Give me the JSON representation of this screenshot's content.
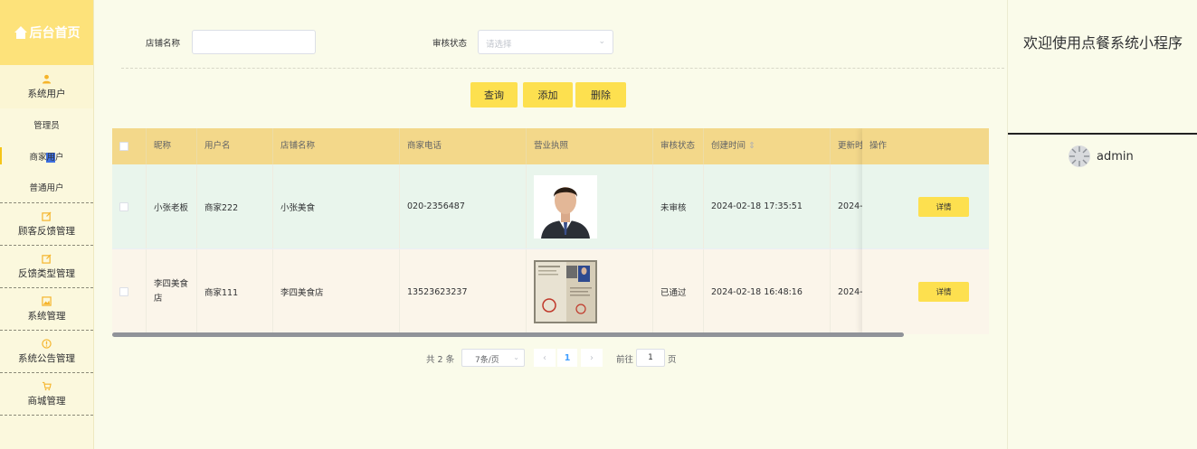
{
  "sidebar": {
    "home_label": "后台首页",
    "groups": [
      {
        "label": "系统用户",
        "icon": "user-icon"
      },
      {
        "label": "顾客反馈管理",
        "icon": "edit-icon"
      },
      {
        "label": "反馈类型管理",
        "icon": "edit-icon"
      },
      {
        "label": "系统管理",
        "icon": "picture-icon"
      },
      {
        "label": "系统公告管理",
        "icon": "info-icon"
      },
      {
        "label": "商城管理",
        "icon": "cart-icon"
      }
    ],
    "sub_items": [
      {
        "label": "管理员"
      },
      {
        "label_a": "商家",
        "label_b": "用",
        "label_c": "户",
        "active": true
      },
      {
        "label": "普通用户"
      }
    ]
  },
  "search": {
    "shop_name_label": "店铺名称",
    "shop_name_value": "",
    "status_label": "审核状态",
    "status_placeholder": "请选择"
  },
  "actions": {
    "query": "查询",
    "add": "添加",
    "delete": "删除"
  },
  "table": {
    "columns": [
      "昵称",
      "用户名",
      "店铺名称",
      "商家电话",
      "营业执照",
      "审核状态",
      "创建时间",
      "更新时间",
      "操作"
    ],
    "update_col_visible": "更新时",
    "sort_indicator": "⇕",
    "rows": [
      {
        "nickname": "小张老板",
        "username": "商家222",
        "shop": "小张美食",
        "phone": "020-2356487",
        "license_image": "portrait-photo",
        "status": "未审核",
        "created": "2024-02-18 17:35:51",
        "updated_visible": "2024-0",
        "action": "详情"
      },
      {
        "nickname": "李四美食店",
        "username": "商家111",
        "shop": "李四美食店",
        "phone": "13523623237",
        "license_image": "business-license-photo",
        "status": "已通过",
        "created": "2024-02-18 16:48:16",
        "updated_visible": "2024-0",
        "action": "详情"
      }
    ]
  },
  "pagination": {
    "total": "共 2 条",
    "page_size": "7条/页",
    "current": "1",
    "goto_label": "前往",
    "goto_value": "1",
    "page_suffix": "页"
  },
  "right_panel": {
    "welcome": "欢迎使用点餐系统小程序",
    "username": "admin"
  },
  "colors": {
    "accent": "#fde04f",
    "header_bg": "#f3d88a",
    "sidebar_home": "#fde27a",
    "row_hover": "#e9f5ec"
  }
}
